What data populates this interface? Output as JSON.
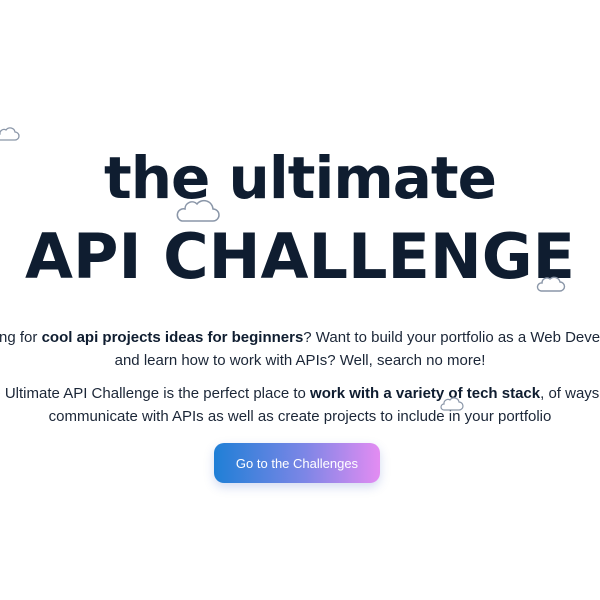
{
  "hero": {
    "title_line_1": "the ultimate",
    "title_line_2": "API CHALLENGE"
  },
  "intro": {
    "line_1_start": "king for ",
    "line_1_bold": "cool api projects ideas for beginners",
    "line_1_end": "? Want to build your portfolio as a Web Develo",
    "line_2": "and learn how to work with APIs? Well, search no more!"
  },
  "description": {
    "line_1_start": "e Ultimate API Challenge is the perfect place to ",
    "line_1_bold": "work with a variety of tech stack",
    "line_1_end": ", of ways t",
    "line_2": "communicate with APIs as well as create projects to include in your portfolio"
  },
  "cta": {
    "label": "Go to the Challenges"
  },
  "colors": {
    "title": "#0f1d30",
    "text": "#1b2637",
    "button_gradient_start": "#1f7fd6",
    "button_gradient_end": "#e38cf2",
    "cloud_stroke": "#8a96a8"
  },
  "icons": [
    "cloud-icon"
  ]
}
